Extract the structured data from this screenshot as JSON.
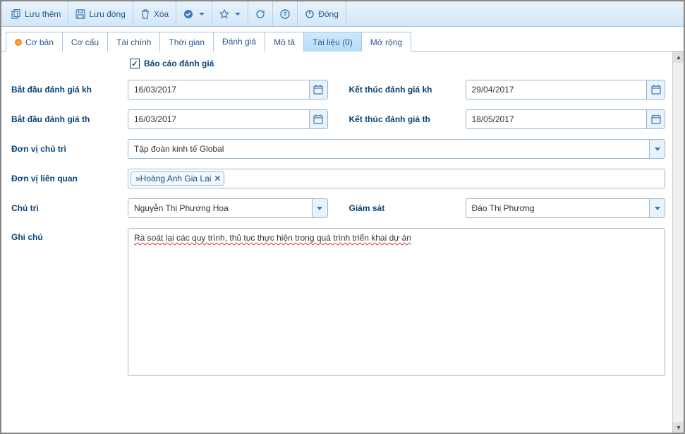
{
  "toolbar": {
    "save_more": "Lưu thêm",
    "save_close": "Lưu đóng",
    "delete": "Xóa",
    "close": "Đóng"
  },
  "tabs": {
    "basic": "Cơ bản",
    "structure": "Cơ cấu",
    "finance": "Tài chính",
    "time": "Thời gian",
    "rating": "Đánh giá",
    "describe": "Mô tả",
    "docs": "Tài liệu (0)",
    "extend": "Mở rộng"
  },
  "form": {
    "report_checkbox_label": "Báo cáo đánh giá",
    "start_plan_label": "Bắt đầu đánh giá kh",
    "start_plan_value": "16/03/2017",
    "end_plan_label": "Kết thúc đánh giá kh",
    "end_plan_value": "29/04/2017",
    "start_actual_label": "Bắt đầu đánh giá th",
    "start_actual_value": "16/03/2017",
    "end_actual_label": "Kết thúc đánh giá th",
    "end_actual_value": "18/05/2017",
    "lead_unit_label": "Đơn vị chủ trì",
    "lead_unit_value": "Tập đoàn kinh tế Global",
    "related_unit_label": "Đơn vị liên quan",
    "related_unit_tag": "»Hoàng Anh Gia Lai",
    "lead_person_label": "Chủ trì",
    "lead_person_value": "Nguyễn Thị Phương Hoa",
    "supervisor_label": "Giám sát",
    "supervisor_value": "Đào Thị Phương",
    "note_label": "Ghi chú",
    "note_value": "Rà soát lại các quy trình, thủ tục thực hiện trong quá trình triển khai dự án"
  }
}
